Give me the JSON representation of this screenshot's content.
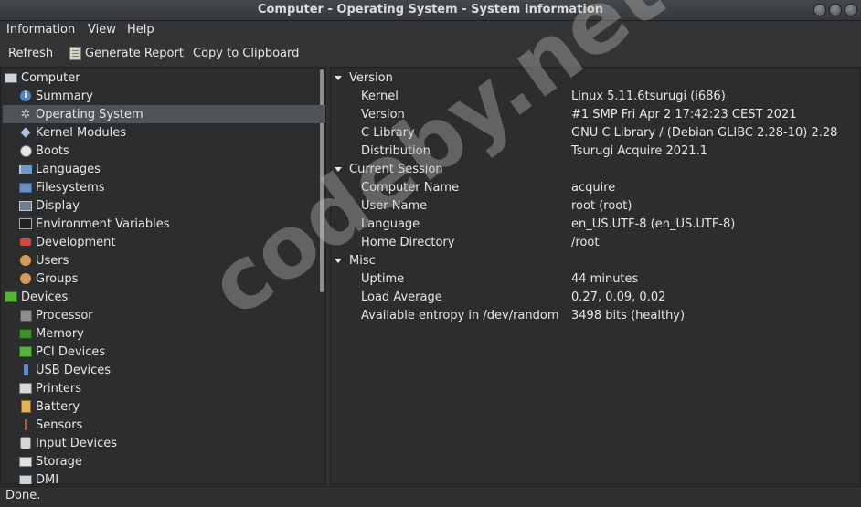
{
  "window": {
    "title": "Computer - Operating System - System Information"
  },
  "menubar": {
    "items": [
      "Information",
      "View",
      "Help"
    ]
  },
  "toolbar": {
    "refresh": "Refresh",
    "generate_report": "Generate Report",
    "copy": "Copy to Clipboard"
  },
  "tree": {
    "computer": "Computer",
    "computer_items": [
      "Summary",
      "Operating System",
      "Kernel Modules",
      "Boots",
      "Languages",
      "Filesystems",
      "Display",
      "Environment Variables",
      "Development",
      "Users",
      "Groups"
    ],
    "devices": "Devices",
    "device_items": [
      "Processor",
      "Memory",
      "PCI Devices",
      "USB Devices",
      "Printers",
      "Battery",
      "Sensors",
      "Input Devices",
      "Storage",
      "DMI"
    ],
    "selected": "Operating System"
  },
  "details": {
    "sections": [
      {
        "title": "Version",
        "rows": [
          {
            "key": "Kernel",
            "value": "Linux 5.11.6tsurugi (i686)"
          },
          {
            "key": "Version",
            "value": "#1 SMP Fri Apr 2 17:42:23 CEST 2021"
          },
          {
            "key": "C Library",
            "value": "GNU C Library / (Debian GLIBC 2.28-10) 2.28"
          },
          {
            "key": "Distribution",
            "value": "Tsurugi Acquire 2021.1"
          }
        ]
      },
      {
        "title": "Current Session",
        "rows": [
          {
            "key": "Computer Name",
            "value": "acquire"
          },
          {
            "key": "User Name",
            "value": "root (root)"
          },
          {
            "key": "Language",
            "value": "en_US.UTF-8 (en_US.UTF-8)"
          },
          {
            "key": "Home Directory",
            "value": "/root"
          }
        ]
      },
      {
        "title": "Misc",
        "rows": [
          {
            "key": "Uptime",
            "value": "44 minutes"
          },
          {
            "key": "Load Average",
            "value": "0.27, 0.09, 0.02"
          },
          {
            "key": "Available entropy in /dev/random",
            "value": "3498 bits (healthy)"
          }
        ]
      }
    ]
  },
  "status": {
    "text": "Done."
  },
  "watermark": "codeby.net",
  "colors": {
    "background": "#2f3133",
    "pane": "#2b2d2f",
    "selection": "#4f5356",
    "text": "#e6e6e6"
  }
}
